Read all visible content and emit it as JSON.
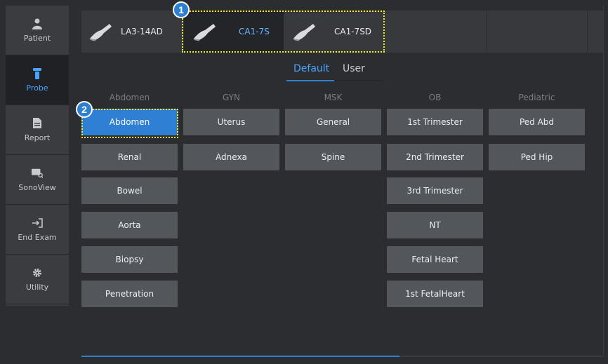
{
  "sidebar": {
    "items": [
      {
        "label": "Patient",
        "icon": "person-icon",
        "active": false
      },
      {
        "label": "Probe",
        "icon": "probe-icon",
        "active": true
      },
      {
        "label": "Report",
        "icon": "document-icon",
        "active": false
      },
      {
        "label": "SonoView",
        "icon": "sonoview-icon",
        "active": false
      },
      {
        "label": "End Exam",
        "icon": "exit-icon",
        "active": false
      },
      {
        "label": "Utility",
        "icon": "gear-icon",
        "active": false
      }
    ]
  },
  "probes": [
    {
      "label": "LA3-14AD",
      "selected": false
    },
    {
      "label": "CA1-7S",
      "selected": true
    },
    {
      "label": "CA1-7SD",
      "selected": false
    }
  ],
  "tabs": [
    {
      "label": "Default",
      "active": true
    },
    {
      "label": "User",
      "active": false
    }
  ],
  "callouts": {
    "one": "1",
    "two": "2"
  },
  "columns": [
    {
      "header": "Abdomen",
      "presets": [
        "Abdomen",
        "Renal",
        "Bowel",
        "Aorta",
        "Biopsy",
        "Penetration"
      ]
    },
    {
      "header": "GYN",
      "presets": [
        "Uterus",
        "Adnexa"
      ]
    },
    {
      "header": "MSK",
      "presets": [
        "General",
        "Spine"
      ]
    },
    {
      "header": "OB",
      "presets": [
        "1st Trimester",
        "2nd Trimester",
        "3rd Trimester",
        "NT",
        "Fetal Heart",
        "1st FetalHeart"
      ]
    },
    {
      "header": "Pediatric",
      "presets": [
        "Ped Abd",
        "Ped Hip"
      ]
    }
  ],
  "selected_preset": "Abdomen",
  "scroll_progress": 0.61,
  "colors": {
    "accent": "#2f7fd4",
    "highlight": "#f2ea2a",
    "active_text": "#4aa3ff"
  }
}
